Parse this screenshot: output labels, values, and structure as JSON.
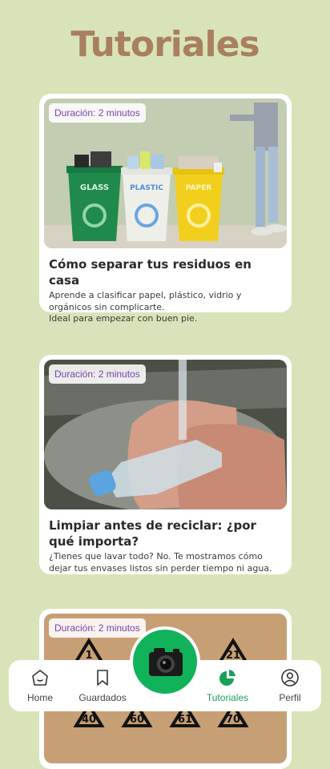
{
  "page": {
    "title": "Tutoriales"
  },
  "tutorials": [
    {
      "duration": "Duración: 2 minutos",
      "title": "Cómo separar tus residuos en casa",
      "description": "Aprende a clasificar papel, plástico, vidrio y orgánicos sin complicarte.\n Ideal para empezar con buen pie.",
      "bins": [
        "GLASS",
        "PLASTIC",
        "PAPER"
      ]
    },
    {
      "duration": "Duración: 2 minutos",
      "title": "Limpiar antes de reciclar: ¿por qué importa?",
      "description": "¿Tienes que lavar todo? No. Te mostramos cómo dejar tus envases listos sin perder tiempo ni agua."
    },
    {
      "duration": "Duración: 2 minutos",
      "codes": [
        "1",
        "21",
        "40",
        "60",
        "61",
        "70"
      ]
    }
  ],
  "nav": {
    "items": [
      {
        "label": "Home",
        "icon": "home-icon"
      },
      {
        "label": "Guardados",
        "icon": "bookmark-icon"
      },
      {
        "label": "Tutoriales",
        "icon": "pie-chart-icon"
      },
      {
        "label": "Perfil",
        "icon": "user-icon"
      }
    ],
    "camera_icon": "camera-icon"
  },
  "colors": {
    "background": "#d9e3b9",
    "title": "#a8805f",
    "accent": "#12b25a",
    "badge_text": "#7b3fb0"
  }
}
